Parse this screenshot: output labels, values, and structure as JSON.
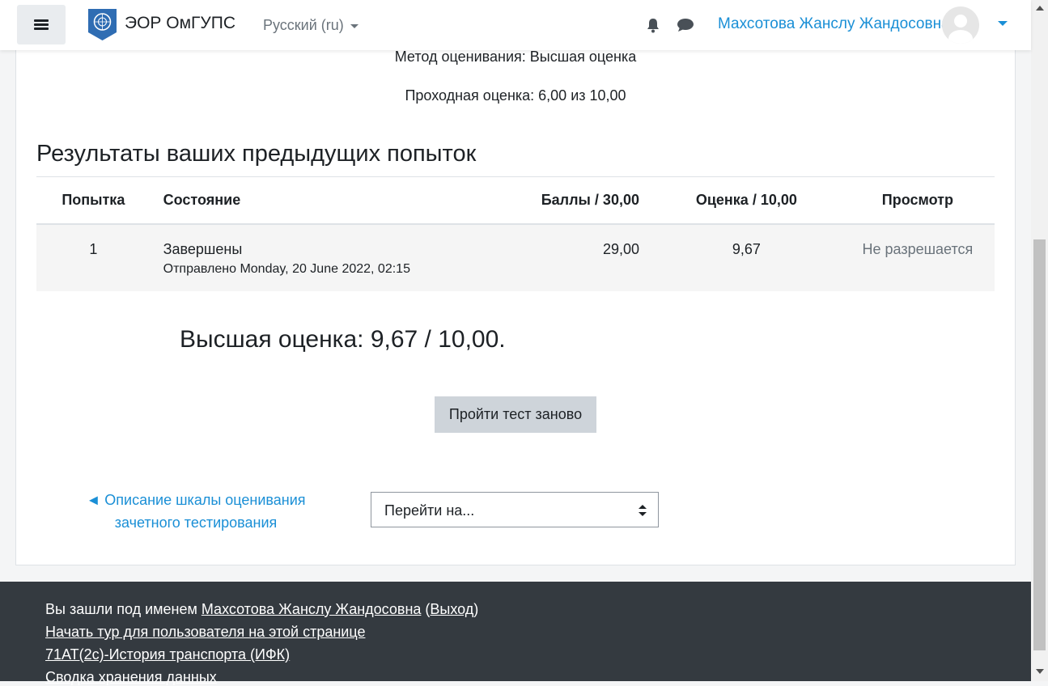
{
  "navbar": {
    "site_name": "ЭОР ОмГУПС",
    "language": "Русский (ru)",
    "user_name": "Махсотова Жанслу Жандосовна"
  },
  "quiz": {
    "grading_method": "Метод оценивания: Высшая оценка",
    "passing_grade": "Проходная оценка: 6,00 из 10,00",
    "section_title": "Результаты ваших предыдущих попыток",
    "table": {
      "headers": [
        "Попытка",
        "Состояние",
        "Баллы / 30,00",
        "Оценка / 10,00",
        "Просмотр"
      ],
      "rows": [
        {
          "attempt": "1",
          "state": "Завершены",
          "submitted": "Отправлено Monday, 20 June 2022, 02:15",
          "marks": "29,00",
          "grade": "9,67",
          "review": "Не разрешается"
        }
      ]
    },
    "best_grade": "Высшая оценка: 9,67 / 10,00.",
    "retry_button": "Пройти тест заново",
    "prev_activity": "◄ Описание шкалы оценивания зачетного тестирования",
    "jump_to": "Перейти на..."
  },
  "footer": {
    "logged_in_prefix": "Вы зашли под именем",
    "logged_in_user": "Махсотова Жанслу Жандосовна",
    "logout_open": "(",
    "logout": "Выход",
    "logout_close": ")",
    "tour_link": "Начать тур для пользователя на этой странице",
    "course_link": "71АТ(2с)-История транспорта (ИФК)",
    "data_retention": "Сводка хранения данных"
  },
  "colors": {
    "link": "#1a8fd6",
    "footer_bg": "#343a40",
    "button_bg": "#ced4da",
    "row_bg": "#f5f5f5"
  }
}
